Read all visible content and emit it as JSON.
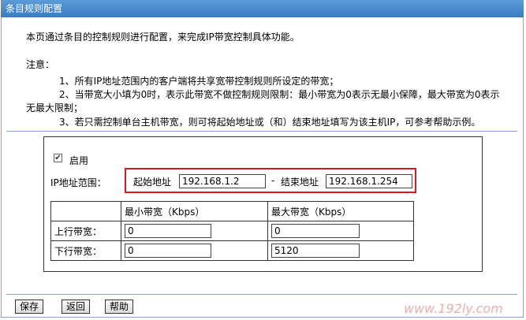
{
  "window": {
    "title": "条目规则配置"
  },
  "intro": "本页通过条目的控制规则进行配置，来完成IP带宽控制具体功能。",
  "notes": {
    "label": "注意：",
    "lines": [
      "1、所有IP地址范围内的客户端将共享宽带控制规则所设定的带宽；",
      "2、当带宽大小填为0时，表示此带宽不做控制规则限制：最小带宽为0表示无最小保障，最大带宽为0表示",
      "无最大限制；",
      "3、若只需控制单台主机带宽，则可将起始地址或（和）结束地址填写为该主机IP，可参考帮助示例。"
    ]
  },
  "form": {
    "enable_label": "启用",
    "enabled": true,
    "ip_range_label": "IP地址范围：",
    "start_label": "起始地址",
    "start_value": "192.168.1.2",
    "dash": "-",
    "end_label": "结束地址",
    "end_value": "192.168.1.254"
  },
  "bandwidth": {
    "col_min": "最小带宽（Kbps）",
    "col_max": "最大带宽（Kbps）",
    "rows": [
      {
        "label": "上行带宽：",
        "min": "0",
        "max": "0"
      },
      {
        "label": "下行带宽：",
        "min": "0",
        "max": "5120"
      }
    ]
  },
  "buttons": {
    "save": "保存",
    "back": "返回",
    "help": "帮助"
  },
  "watermark": "www.192ly.com"
}
